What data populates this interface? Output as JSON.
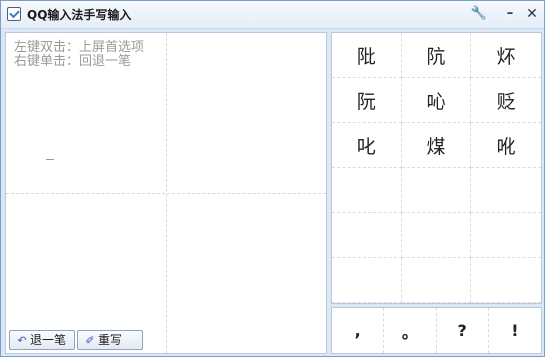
{
  "window": {
    "title": "QQ输入法手写输入",
    "settings_glyph": "🔧",
    "minimize_glyph": "–",
    "close_glyph": "✕"
  },
  "pad": {
    "hint_line1": "左键双击：上屏首选项",
    "hint_line2": "右键单击：回退一笔",
    "undo_label": "退一笔",
    "undo_glyph": "↶",
    "rewrite_label": "重写",
    "rewrite_glyph": "✐"
  },
  "candidates": [
    [
      "阰",
      "阬",
      "炋"
    ],
    [
      "阮",
      "吣",
      "贬"
    ],
    [
      "叱",
      "煤",
      "吪"
    ],
    [
      "",
      "",
      ""
    ],
    [
      "",
      "",
      ""
    ],
    [
      "",
      "",
      ""
    ]
  ],
  "punctuation": [
    ",",
    "。",
    "?",
    "!"
  ]
}
